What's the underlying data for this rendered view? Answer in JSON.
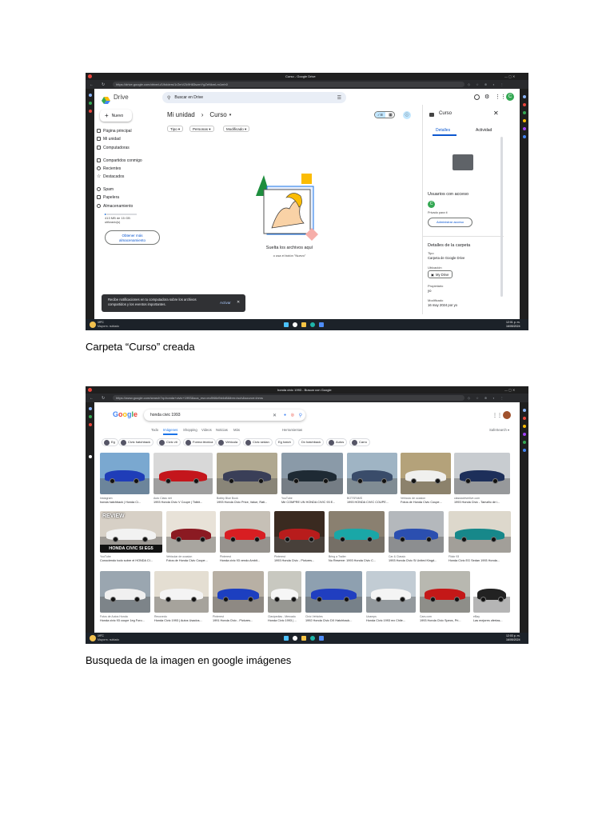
{
  "captions": {
    "first": "Carpeta “Curso” creada",
    "second": "Busqueda de la imagen en google imágenes"
  },
  "drive": {
    "window_title": "Curso - Google Drive",
    "url": "https://drive.google.com/drive/u/1/folders/1rZmVZk9H83szmYgZeNkmLm1mh0",
    "logo_text": "Drive",
    "search_placeholder": "Buscar en Drive",
    "new_button": "Nuevo",
    "nav": [
      "Página principal",
      "Mi unidad",
      "Computadoras",
      "Compartidos conmigo",
      "Recientes",
      "Destacados",
      "Spam",
      "Papelera",
      "Almacenamiento"
    ],
    "storage_text": "413 MB de 15 GB utilizado(s)",
    "get_storage_button": "Obtener más almacenamiento",
    "breadcrumb_root": "Mi unidad",
    "breadcrumb_sep": "›",
    "breadcrumb_current": "Curso",
    "filters": [
      "Tipo",
      "Personas",
      "Modificado"
    ],
    "empty_title": "Suelta los archivos aquí",
    "empty_sub": "o usa el botón \"Nuevo\"",
    "notification_text": "Recibe notificaciones en tu computadora sobre los archivos compartidos y los eventos importantes.",
    "notification_action": "Activar",
    "details": {
      "title": "Curso",
      "tab_details": "Detalles",
      "tab_activity": "Actividad",
      "access_label": "Usuarios con acceso",
      "access_sub": "Privado para ti",
      "manage_button": "Administrar acceso",
      "section_title": "Detalles de la carpeta",
      "type_label": "Tipo",
      "type_value": "Carpeta de Google Drive",
      "location_label": "Ubicación",
      "location_value": "My Drive",
      "owner_label": "Propietario",
      "owner_value": "yo",
      "modified_label": "Modificado",
      "modified_value": "16 may 2024 por yo"
    },
    "avatar_letter": "C",
    "taskbar_left_top": "19°C",
    "taskbar_left_bottom": "Mayorm. nublado",
    "taskbar_time": "12:01 p. m.",
    "taskbar_date": "16/05/2024"
  },
  "google": {
    "window_title": "honda civic 1993 - Buscar con Google",
    "url": "https://www.google.com/search?q=honda+civic+1993&sca_esv=ec8f46d9d4d8&tbm=isch&source=lnms",
    "logo": "Google",
    "query": "honda civic 1993",
    "tabs": [
      "Todo",
      "Imágenes",
      "Shopping",
      "Videos",
      "Noticias",
      "Más",
      "Herramientas"
    ],
    "safesearch": "SafeSearch",
    "chips": [
      "Eg",
      "Civic hatchback",
      "Civic vti",
      "Forma técnica",
      "Vehicula",
      "Civic sedan",
      "Eg hatch",
      "Dx hatchback",
      "Autos",
      "Carro"
    ],
    "results": [
      {
        "source": "Instagram",
        "title": "honda hatchback | Honda Ci..."
      },
      {
        "source": "Auto Class net",
        "title": "1993 Honda Civic V Coupe | Tidbit..."
      },
      {
        "source": "Bobby Blue Book",
        "title": "1993 Honda Civic Price, Value, Rati..."
      },
      {
        "source": "YouTube",
        "title": "Me COMPRE UN HONDA CIVIC 93 E..."
      },
      {
        "source": "BOTSFAMS",
        "title": "1993 HONDA CIVIC COUPE..."
      },
      {
        "source": "Vehiculo de ocasion",
        "title": "Fotos de Honda Civic Coupe..."
      },
      {
        "source": "classicdriverlive.com",
        "title": "1993 Honda Civic - Tamaño de i..."
      },
      {
        "source": "YouTube",
        "title": "Conociendo todo sobre el HONDA CI..."
      },
      {
        "source": "Vehicular de ocasion",
        "title": "Fotos de Honda Civic Coupe..."
      },
      {
        "source": "Pinterest",
        "title": "Honda civic 93 vendo Ambit..."
      },
      {
        "source": "Pinterest",
        "title": "1993 Honda Civic - Pictures..."
      },
      {
        "source": "Bring a Trailer",
        "title": "No Reserve: 1993 Honda Civic C..."
      },
      {
        "source": "Car & Classic",
        "title": "1993 Honda Civic Si United Kingd..."
      },
      {
        "source": "Flickr 93",
        "title": "Honda Civic EG Sedan 1993 Honda..."
      },
      {
        "source": "Fotos de Autos Honda",
        "title": "Honda civic 93 coupe 1eg Foro..."
      },
      {
        "source": "Recovedo",
        "title": "Honda Civic 1993 | Autos Usados..."
      },
      {
        "source": "Pinterest",
        "title": "1991 Honda Civic - Pictures..."
      },
      {
        "source": "Clasipedias - Mercado",
        "title": "Honda Civic 1993 | ..."
      },
      {
        "source": "Civic Vehicles",
        "title": "1992 Honda Civic DX Hatchback..."
      },
      {
        "source": "Ucamps",
        "title": "Honda Civic 1993 mx Chile..."
      },
      {
        "source": "Cars.com",
        "title": "1993 Honda Civic Specs, Pri..."
      },
      {
        "source": "eBay",
        "title": "Las mejores ofertas..."
      }
    ],
    "youtube_banner": "HONDA CIVIC SI EG5",
    "review_text": "REVIEW",
    "taskbar_left_top": "19°C",
    "taskbar_left_bottom": "Mayorm. nublado",
    "taskbar_time": "12:03 p. m.",
    "taskbar_date": "16/05/2024"
  }
}
